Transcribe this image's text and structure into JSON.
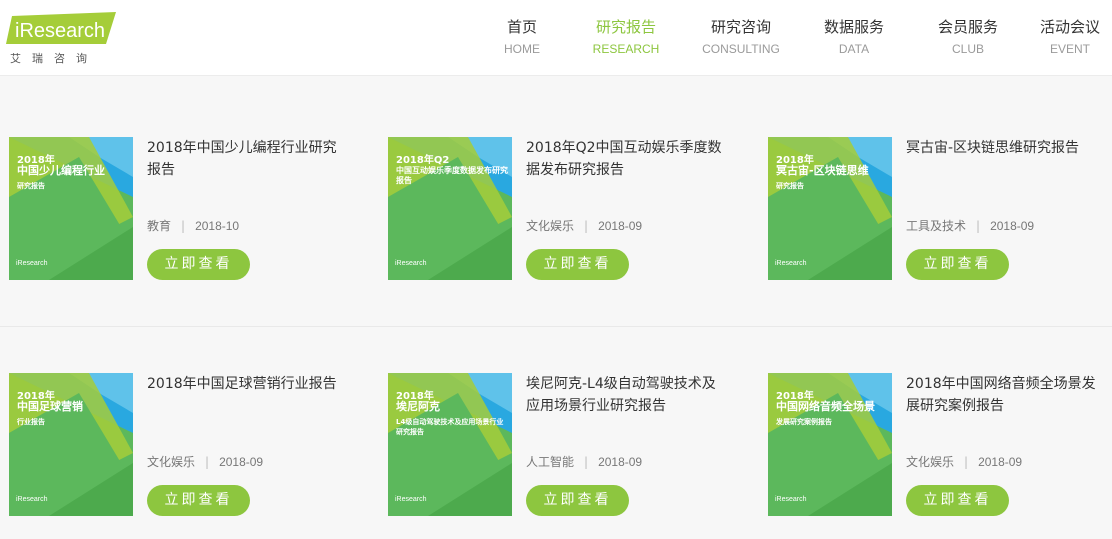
{
  "brand": {
    "logo_text": "iResearch",
    "logo_sub": "艾瑞咨询"
  },
  "nav": [
    {
      "cn": "首页",
      "en": "HOME",
      "active": false
    },
    {
      "cn": "研究报告",
      "en": "RESEARCH",
      "active": true
    },
    {
      "cn": "研究咨询",
      "en": "CONSULTING",
      "active": false
    },
    {
      "cn": "数据服务",
      "en": "DATA",
      "active": false
    },
    {
      "cn": "会员服务",
      "en": "CLUB",
      "active": false
    },
    {
      "cn": "活动会议",
      "en": "EVENT",
      "active": false
    }
  ],
  "colors": {
    "accent": "#8dc63f",
    "thumb_green": "#5cb85c",
    "thumb_lime": "#a5cd39",
    "thumb_blue": "#29a8e0"
  },
  "view_button_label": "立即查看",
  "reports": [
    {
      "title": "2018年中国少儿编程行业研究报告",
      "category": "教育",
      "date": "2018-10",
      "thumb_year": "2018年",
      "thumb_title": "中国少儿编程行业",
      "thumb_sub": "研究报告"
    },
    {
      "title": "2018年Q2中国互动娱乐季度数据发布研究报告",
      "category": "文化娱乐",
      "date": "2018-09",
      "thumb_year": "2018年Q2",
      "thumb_title": "",
      "thumb_sub": "中国互动娱乐季度数据发布研究报告"
    },
    {
      "title": "冥古宙-区块链思维研究报告",
      "category": "工具及技术",
      "date": "2018-09",
      "thumb_year": "2018年",
      "thumb_title": "冥古宙-区块链思维",
      "thumb_sub": "研究报告"
    },
    {
      "title": "2018年中国足球营销行业报告",
      "category": "文化娱乐",
      "date": "2018-09",
      "thumb_year": "2018年",
      "thumb_title": "中国足球营销",
      "thumb_sub": "行业报告"
    },
    {
      "title": "埃尼阿克-L4级自动驾驶技术及应用场景行业研究报告",
      "category": "人工智能",
      "date": "2018-09",
      "thumb_year": "2018年",
      "thumb_title": "埃尼阿克",
      "thumb_sub": "L4级自动驾驶技术及应用场景行业研究报告"
    },
    {
      "title": "2018年中国网络音频全场景发展研究案例报告",
      "category": "文化娱乐",
      "date": "2018-09",
      "thumb_year": "2018年",
      "thumb_title": "中国网络音频全场景",
      "thumb_sub": "发展研究案例报告"
    }
  ]
}
